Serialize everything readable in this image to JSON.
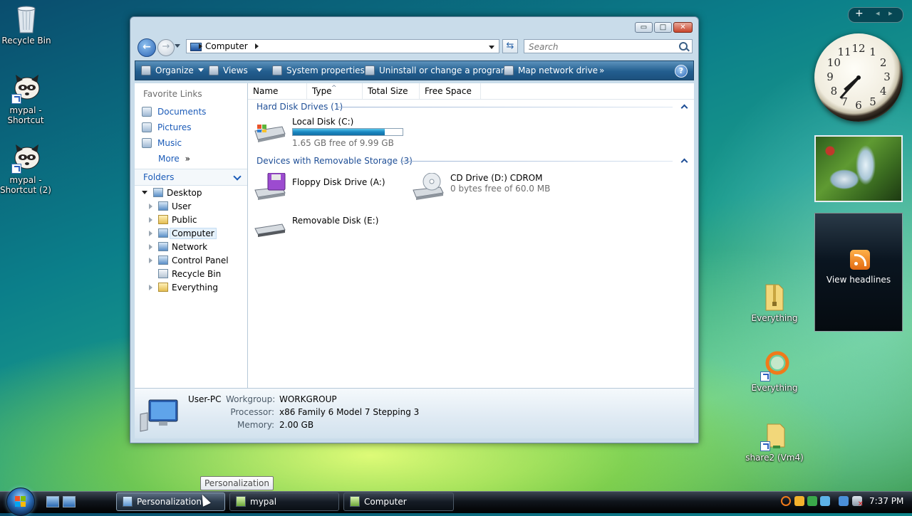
{
  "desktop": {
    "icons_left": [
      {
        "label": "Recycle Bin"
      },
      {
        "label": "mypal - Shortcut"
      },
      {
        "label": "mypal - Shortcut (2)"
      }
    ],
    "icons_right": [
      {
        "label": "Everything"
      },
      {
        "label": "Everything"
      },
      {
        "label": "share2 (Vm4)"
      }
    ]
  },
  "window": {
    "controls": {
      "minimize": "▭",
      "maximize": "□",
      "close": "✕"
    },
    "address": {
      "crumb": "Computer"
    },
    "search": {
      "placeholder": "Search"
    },
    "toolbar": {
      "organize": "Organize",
      "views": "Views",
      "system_properties": "System properties",
      "uninstall": "Uninstall or change a program",
      "map_drive": "Map network drive",
      "more": "»",
      "help": "?"
    },
    "favorite_links": {
      "heading": "Favorite Links",
      "items": [
        "Documents",
        "Pictures",
        "Music"
      ],
      "more": "More",
      "more_arrow": "»"
    },
    "folders": {
      "heading": "Folders",
      "tree": [
        "Desktop",
        "User",
        "Public",
        "Computer",
        "Network",
        "Control Panel",
        "Recycle Bin",
        "Everything"
      ]
    },
    "columns": [
      "Name",
      "Type",
      "Total Size",
      "Free Space"
    ],
    "groups": [
      {
        "title": "Hard Disk Drives (1)",
        "drives": [
          {
            "name": "Local Disk (C:)",
            "space": "1.65 GB free of 9.99 GB",
            "used_fraction": 0.835
          }
        ]
      },
      {
        "title": "Devices with Removable Storage (3)",
        "drives": [
          {
            "name": "Floppy Disk Drive (A:)"
          },
          {
            "name": "CD Drive (D:) CDROM",
            "space": "0 bytes free of 60.0 MB"
          },
          {
            "name": "Removable Disk (E:)"
          }
        ]
      }
    ],
    "details": {
      "pc_name": "User-PC",
      "workgroup_label": "Workgroup:",
      "workgroup": "WORKGROUP",
      "processor_label": "Processor:",
      "processor": "x86 Family 6 Model 7 Stepping 3",
      "memory_label": "Memory:",
      "memory": "2.00 GB"
    }
  },
  "gadgets": {
    "control": {
      "add": "+",
      "prev": "◂",
      "next": "▸"
    },
    "clock": {
      "numbers": [
        "12",
        "1",
        "2",
        "3",
        "4",
        "5",
        "6",
        "7",
        "8",
        "9",
        "10",
        "11"
      ],
      "time": "7:37"
    },
    "feed": {
      "label": "View headlines"
    }
  },
  "taskbar": {
    "buttons": [
      "Personalization",
      "mypal",
      "Computer"
    ],
    "tooltip": "Personalization",
    "clock": "7:37 PM"
  },
  "colors": {
    "accent": "#1b5bb8",
    "progress": "#1a86c0"
  }
}
